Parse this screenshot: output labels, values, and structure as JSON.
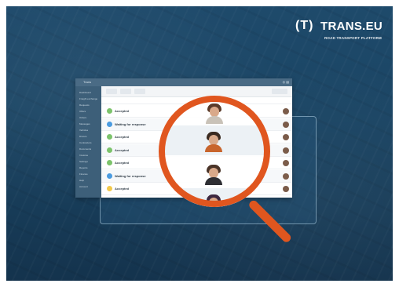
{
  "brand": {
    "mark": "(T)",
    "name": "TRANS.EU",
    "tagline": "ROAD TRANSPORT PLATFORM"
  },
  "colors": {
    "background": "#1b4564",
    "magnifier": "#e0561f",
    "accepted": "#7cc36b",
    "waiting": "#4a9be0",
    "pending": "#f2c94c"
  },
  "app": {
    "window_title": "Trans",
    "window_icons": "◎ ▤",
    "sidebar": [
      "Dashboard",
      "Freight exchange",
      "Requests",
      "Offers",
      "Orders",
      "Messages",
      "Vehicles",
      "Drivers",
      "Contractors",
      "Documents",
      "Invoices",
      "Settings",
      "Reports",
      "Finance",
      "Help",
      "Account"
    ],
    "rows": [
      {
        "status": "Accepted",
        "status_color": "#7cc36b"
      },
      {
        "status": "Waiting for response",
        "status_color": "#4a9be0"
      },
      {
        "status": "Accepted",
        "status_color": "#7cc36b"
      },
      {
        "status": "Accepted",
        "status_color": "#7cc36b"
      },
      {
        "status": "Accepted",
        "status_color": "#7cc36b"
      },
      {
        "status": "Waiting for response",
        "status_color": "#4a9be0"
      },
      {
        "status": "Accepted",
        "status_color": "#f2c94c"
      }
    ]
  },
  "magnifier": {
    "people_icons": [
      "person-avatar-female",
      "person-avatar-bearded-man",
      "person-avatar-man",
      "person-avatar-woman-purple"
    ]
  }
}
